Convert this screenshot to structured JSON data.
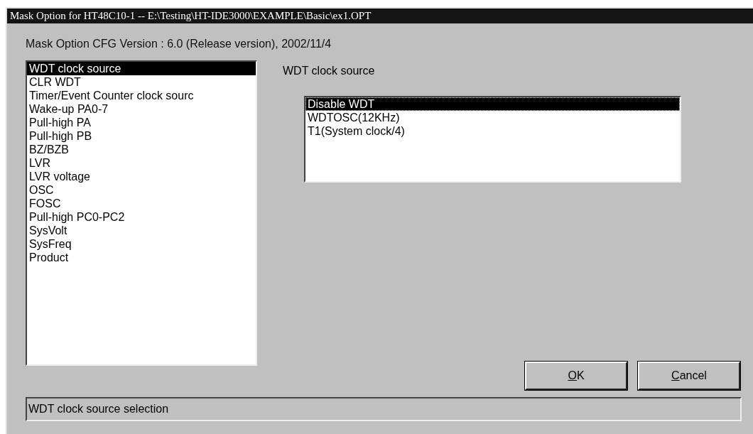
{
  "window": {
    "title": "Mask Option for HT48C10-1 -- E:\\Testing\\HT-IDE3000\\EXAMPLE\\Basic\\ex1.OPT"
  },
  "version_text": "Mask Option CFG Version : 6.0 (Release version), 2002/11/4",
  "option_list": [
    {
      "label": "WDT clock source",
      "selected": true
    },
    {
      "label": "CLR WDT",
      "selected": false
    },
    {
      "label": "Timer/Event Counter clock sourc",
      "selected": false
    },
    {
      "label": "Wake-up PA0-7",
      "selected": false
    },
    {
      "label": "Pull-high PA",
      "selected": false
    },
    {
      "label": "Pull-high PB",
      "selected": false
    },
    {
      "label": "BZ/BZB",
      "selected": false
    },
    {
      "label": "LVR",
      "selected": false
    },
    {
      "label": "LVR voltage",
      "selected": false
    },
    {
      "label": "OSC",
      "selected": false
    },
    {
      "label": "FOSC",
      "selected": false
    },
    {
      "label": "Pull-high PC0-PC2",
      "selected": false
    },
    {
      "label": "SysVolt",
      "selected": false
    },
    {
      "label": "SysFreq",
      "selected": false
    },
    {
      "label": "Product",
      "selected": false
    }
  ],
  "detail": {
    "heading": "WDT clock source",
    "choices": [
      {
        "label": "Disable WDT",
        "selected": true
      },
      {
        "label": "WDTOSC(12KHz)",
        "selected": false
      },
      {
        "label": "T1(System clock/4)",
        "selected": false
      }
    ]
  },
  "buttons": [
    {
      "label": "OK",
      "underline_first": true
    },
    {
      "label": "Cancel",
      "underline_first": true
    }
  ],
  "status_bar": "WDT clock source selection"
}
